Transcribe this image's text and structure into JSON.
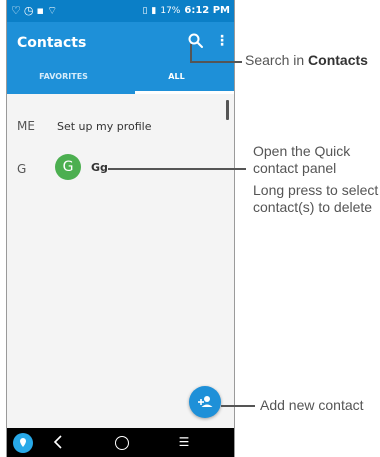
{
  "status_bar": {
    "left_icons": [
      "heart-icon",
      "clock-icon",
      "image-icon",
      "wifi-icon"
    ],
    "battery": "17%",
    "time": "6:12 PM"
  },
  "app_bar": {
    "title": "Contacts",
    "tabs": [
      {
        "label": "FAVORITES",
        "selected": false
      },
      {
        "label": "ALL",
        "selected": true
      }
    ]
  },
  "contacts": {
    "me_header": "ME",
    "me_text": "Set up my profile",
    "group_header": "G",
    "items": [
      {
        "initial": "G",
        "name": "Gg",
        "avatar_color": "#4caf50"
      }
    ]
  },
  "callouts": {
    "search_prefix": "Search in ",
    "search_bold": "Contacts",
    "quick_panel_line1": "Open the Quick",
    "quick_panel_line2": "contact panel",
    "long_press_line1": "Long press to select",
    "long_press_line2": "contact(s) to delete",
    "add_contact": "Add new contact"
  },
  "colors": {
    "app_bar": "#1e90d8",
    "status_bar": "#0b7fc7",
    "fab": "#1e90d8",
    "avatar": "#4caf50",
    "callout_text": "#555555"
  }
}
